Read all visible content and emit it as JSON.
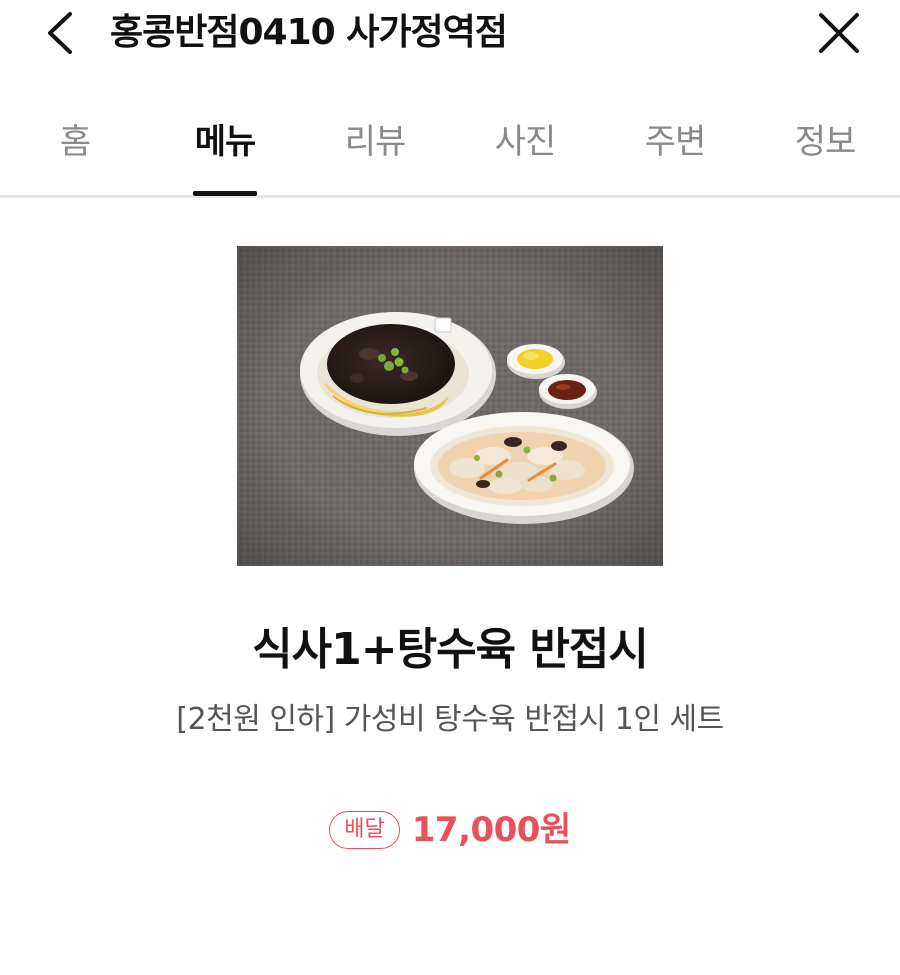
{
  "header": {
    "title": "홍콩반점0410 사가정역점",
    "back_icon": "chevron-left-icon",
    "close_icon": "close-icon"
  },
  "tabs": [
    {
      "label": "홈",
      "active": false
    },
    {
      "label": "메뉴",
      "active": true
    },
    {
      "label": "리뷰",
      "active": false
    },
    {
      "label": "사진",
      "active": false
    },
    {
      "label": "주변",
      "active": false
    },
    {
      "label": "정보",
      "active": false
    }
  ],
  "menu": {
    "name": "식사1+탕수육 반접시",
    "description": "[2천원 인하] 가성비 탕수육 반접시 1인 세트",
    "badge": "배달",
    "price": "17,000원"
  },
  "colors": {
    "accent": "#e8505b",
    "tab_active": "#111111",
    "tab_inactive": "#8a8a8a"
  }
}
